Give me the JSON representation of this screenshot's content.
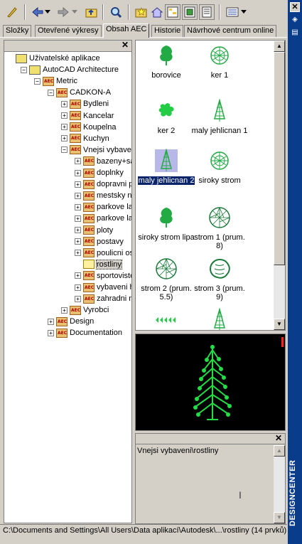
{
  "tabs": [
    "Složky",
    "Otevřené výkresy",
    "Obsah AEC",
    "Historie",
    "Návrhové centrum online"
  ],
  "tree": [
    {
      "label": "Uživatelské aplikace",
      "depth": 0,
      "toggle": "",
      "icon": "ual"
    },
    {
      "label": "AutoCAD Architecture",
      "depth": 1,
      "toggle": "−",
      "icon": "ual"
    },
    {
      "label": "Metric",
      "depth": 2,
      "toggle": "−",
      "icon": "aec"
    },
    {
      "label": "CADKON-A",
      "depth": 3,
      "toggle": "−",
      "icon": "aec"
    },
    {
      "label": "Bydleni",
      "depth": 4,
      "toggle": "+",
      "icon": "aec"
    },
    {
      "label": "Kancelar",
      "depth": 4,
      "toggle": "+",
      "icon": "aec"
    },
    {
      "label": "Koupelna",
      "depth": 4,
      "toggle": "+",
      "icon": "aec"
    },
    {
      "label": "Kuchyn",
      "depth": 4,
      "toggle": "+",
      "icon": "aec"
    },
    {
      "label": "Vnejsi vybaveni",
      "depth": 4,
      "toggle": "−",
      "icon": "aec"
    },
    {
      "label": "bazeny+saur",
      "depth": 5,
      "toggle": "+",
      "icon": "aec"
    },
    {
      "label": "doplnky",
      "depth": 5,
      "toggle": "+",
      "icon": "aec"
    },
    {
      "label": "dopravni pros",
      "depth": 5,
      "toggle": "+",
      "icon": "aec"
    },
    {
      "label": "mestsky nabo",
      "depth": 5,
      "toggle": "+",
      "icon": "aec"
    },
    {
      "label": "parkove lamp",
      "depth": 5,
      "toggle": "+",
      "icon": "aec"
    },
    {
      "label": "parkove lamp",
      "depth": 5,
      "toggle": "+",
      "icon": "aec"
    },
    {
      "label": "ploty",
      "depth": 5,
      "toggle": "+",
      "icon": "aec"
    },
    {
      "label": "postavy",
      "depth": 5,
      "toggle": "+",
      "icon": "aec"
    },
    {
      "label": "poulicni osve",
      "depth": 5,
      "toggle": "+",
      "icon": "aec"
    },
    {
      "label": "rostliny",
      "depth": 5,
      "toggle": "",
      "icon": "folder-open",
      "selected": true
    },
    {
      "label": "sportoviste",
      "depth": 5,
      "toggle": "+",
      "icon": "aec"
    },
    {
      "label": "vybaveni hris",
      "depth": 5,
      "toggle": "+",
      "icon": "aec"
    },
    {
      "label": "zahradni nab",
      "depth": 5,
      "toggle": "+",
      "icon": "aec"
    },
    {
      "label": "Vyrobci",
      "depth": 4,
      "toggle": "+",
      "icon": "aec"
    },
    {
      "label": "Design",
      "depth": 3,
      "toggle": "+",
      "icon": "aec"
    },
    {
      "label": "Documentation",
      "depth": 3,
      "toggle": "+",
      "icon": "aec"
    }
  ],
  "items": [
    {
      "label": "borovice",
      "icon": "tree-side"
    },
    {
      "label": "ker 1",
      "icon": "round-shrub"
    },
    {
      "label": "ker 2",
      "icon": "bush-top"
    },
    {
      "label": "maly jehlicnan 1",
      "icon": "conifer"
    },
    {
      "label": "maly jehlicnan 2",
      "icon": "conifer",
      "selected": true
    },
    {
      "label": "siroky strom",
      "icon": "round-shrub"
    },
    {
      "label": "siroky strom lipa",
      "icon": "tree-side"
    },
    {
      "label": "strom 1 (prum. 8)",
      "icon": "tree-plan"
    },
    {
      "label": "strom 2 (prum. 5.5)",
      "icon": "tree-plan"
    },
    {
      "label": "strom 3 (prum. 9)",
      "icon": "tree-plan2"
    },
    {
      "label": "",
      "icon": "hedge"
    },
    {
      "label": "",
      "icon": "conifer"
    }
  ],
  "description": "Vnejsi vybaveni\\rostliny",
  "status": "C:\\Documents and Settings\\All Users\\Data aplikací\\Autodesk\\...\\rostliny (14 prvků)",
  "designcenter_label": "DESIGNCENTER",
  "colors": {
    "green": "#22dd44",
    "sidebar": "#0a3c8c",
    "selection": "#0a246a"
  }
}
